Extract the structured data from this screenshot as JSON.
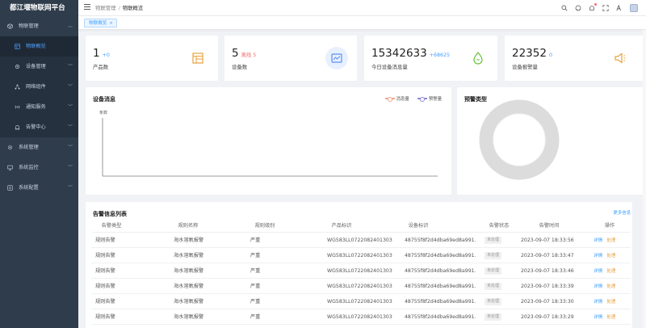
{
  "app": {
    "title": "都江堰物联网平台"
  },
  "sidebar": {
    "items": [
      {
        "label": "物联管理",
        "icon": "cube-icon",
        "expanded": true
      },
      {
        "label": "物联概览",
        "icon": "dashboard-icon",
        "active": true
      },
      {
        "label": "设备管理",
        "icon": "gear-icon"
      },
      {
        "label": "网络组件",
        "icon": "network-icon"
      },
      {
        "label": "通知服务",
        "icon": "broadcast-icon"
      },
      {
        "label": "告警中心",
        "icon": "alarm-icon"
      },
      {
        "label": "系统管理",
        "icon": "settings-icon"
      },
      {
        "label": "系统监控",
        "icon": "monitor-icon"
      },
      {
        "label": "系统配置",
        "icon": "config-icon"
      }
    ]
  },
  "breadcrumb": {
    "parent": "物联管理",
    "sep": "/",
    "current": "物联概览"
  },
  "tags": {
    "active_tag": "物联概览",
    "close": "×"
  },
  "stats": {
    "products": {
      "value": "1",
      "delta": "+0",
      "label": "产品数",
      "icon": "product-icon"
    },
    "devices": {
      "value": "5",
      "delta": "离线 5",
      "label": "设备数",
      "icon": "device-icon"
    },
    "messages": {
      "value": "15342633",
      "delta": "+68625",
      "label": "今日设备消息量",
      "icon": "message-icon"
    },
    "alarms": {
      "value": "22352",
      "delta": "0",
      "label": "设备报警量",
      "icon": "alarm-horn-icon"
    }
  },
  "device_msg": {
    "title": "设备消息",
    "ytitle": "条数",
    "legend": {
      "message": "消息量",
      "alarm": "预警量"
    }
  },
  "alarm_type": {
    "title": "预警类型"
  },
  "alarm_table": {
    "title": "告警信息列表",
    "more": "更多信息",
    "columns": [
      "告警类型",
      "规则名称",
      "规则级别",
      "产品标识",
      "设备标识",
      "告警状态",
      "告警时间",
      "操作"
    ],
    "rows": [
      {
        "type": "规则告警",
        "rule": "海水溶氧报警",
        "level": "严重",
        "product": "WG583LL0722082401303",
        "device": "48755f8f2d4dba69ed8a991...",
        "status": "未处理",
        "time": "2023-09-07 18:33:56",
        "detail": "详情",
        "handle": "处理"
      },
      {
        "type": "规则告警",
        "rule": "海水溶氧报警",
        "level": "严重",
        "product": "WG583LL0722082401303",
        "device": "48755f8f2d4dba69ed8a991...",
        "status": "未处理",
        "time": "2023-09-07 18:33:47",
        "detail": "详情",
        "handle": "处理"
      },
      {
        "type": "规则告警",
        "rule": "海水溶氧报警",
        "level": "严重",
        "product": "WG583LL0722082401303",
        "device": "48755f8f2d4dba69ed8a991...",
        "status": "未处理",
        "time": "2023-09-07 18:33:46",
        "detail": "详情",
        "handle": "处理"
      },
      {
        "type": "规则告警",
        "rule": "海水溶氧报警",
        "level": "严重",
        "product": "WG583LL0722082401303",
        "device": "48755f8f2d4dba69ed8a991...",
        "status": "未处理",
        "time": "2023-09-07 18:33:39",
        "detail": "详情",
        "handle": "处理"
      },
      {
        "type": "规则告警",
        "rule": "海水溶氧报警",
        "level": "严重",
        "product": "WG583LL0722082401303",
        "device": "48755f8f2d4dba69ed8a991...",
        "status": "未处理",
        "time": "2023-09-07 18:33:30",
        "detail": "详情",
        "handle": "处理"
      },
      {
        "type": "规则告警",
        "rule": "海水溶氧报警",
        "level": "严重",
        "product": "WG583LL0722082401303",
        "device": "48755f8f2d4dba69ed8a991...",
        "status": "未处理",
        "time": "2023-09-07 18:33:29",
        "detail": "详情",
        "handle": "处理"
      }
    ]
  },
  "colors": {
    "sidebar_bg": "#2f3c4c",
    "accent": "#409eff",
    "offline_red": "#f56c6c",
    "message_series": "#f4a38c",
    "alarm_series": "#8f88d8",
    "product_icon": "#e6a23c",
    "device_icon": "#5b8ff9",
    "message_icon": "#67c23a",
    "alarm_icon": "#e6a23c"
  }
}
